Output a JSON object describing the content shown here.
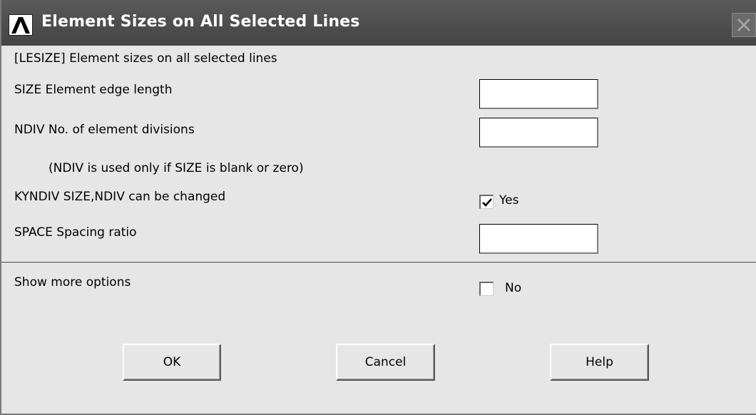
{
  "window": {
    "title": "Element Sizes on All Selected Lines",
    "logo_icon": "ansys-logo-icon",
    "close_icon": "close-icon"
  },
  "command": {
    "description": "[LESIZE]  Element sizes on all selected lines"
  },
  "fields": {
    "size": {
      "label": "SIZE    Element edge length",
      "value": ""
    },
    "ndiv": {
      "label": "NDIV    No. of element divisions",
      "value": ""
    },
    "ndiv_note": "(NDIV is used only if SIZE is blank or zero)",
    "kyndiv": {
      "label": "KYNDIV  SIZE,NDIV can be changed",
      "checked": true,
      "option_label": "Yes"
    },
    "space": {
      "label": "SPACE   Spacing ratio",
      "value": ""
    }
  },
  "more_options": {
    "label": "Show more options",
    "checked": false,
    "option_label": "No"
  },
  "buttons": {
    "ok": "OK",
    "cancel": "Cancel",
    "help": "Help"
  },
  "colors": {
    "titlebar": "#4c4c4c",
    "dialog_bg": "#e6e6e6"
  }
}
